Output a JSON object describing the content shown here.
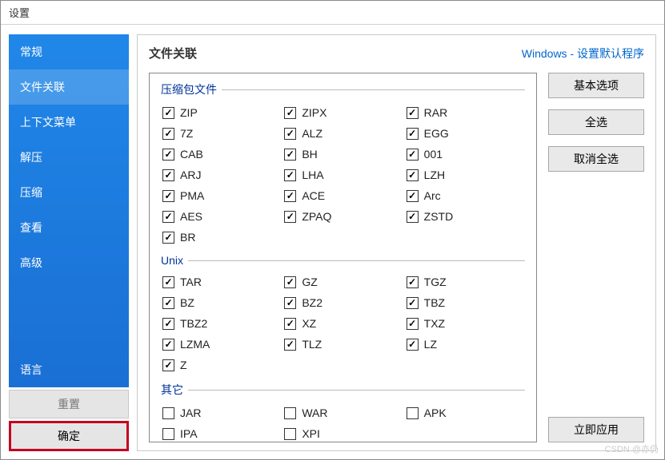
{
  "window": {
    "title": "设置"
  },
  "sidebar": {
    "items": [
      {
        "label": "常规"
      },
      {
        "label": "文件关联"
      },
      {
        "label": "上下文菜单"
      },
      {
        "label": "解压"
      },
      {
        "label": "压缩"
      },
      {
        "label": "查看"
      },
      {
        "label": "高级"
      }
    ],
    "bottom": [
      {
        "label": "语言"
      }
    ],
    "reset": "重置",
    "confirm": "确定"
  },
  "main": {
    "title": "文件关联",
    "link": "Windows - 设置默认程序",
    "groups": [
      {
        "legend": "压缩包文件",
        "items": [
          {
            "label": "ZIP",
            "checked": true
          },
          {
            "label": "ZIPX",
            "checked": true
          },
          {
            "label": "RAR",
            "checked": true
          },
          {
            "label": "7Z",
            "checked": true
          },
          {
            "label": "ALZ",
            "checked": true
          },
          {
            "label": "EGG",
            "checked": true
          },
          {
            "label": "CAB",
            "checked": true
          },
          {
            "label": "BH",
            "checked": true
          },
          {
            "label": "001",
            "checked": true
          },
          {
            "label": "ARJ",
            "checked": true
          },
          {
            "label": "LHA",
            "checked": true
          },
          {
            "label": "LZH",
            "checked": true
          },
          {
            "label": "PMA",
            "checked": true
          },
          {
            "label": "ACE",
            "checked": true
          },
          {
            "label": "Arc",
            "checked": true
          },
          {
            "label": "AES",
            "checked": true
          },
          {
            "label": "ZPAQ",
            "checked": true
          },
          {
            "label": "ZSTD",
            "checked": true
          },
          {
            "label": "BR",
            "checked": true
          }
        ]
      },
      {
        "legend": "Unix",
        "items": [
          {
            "label": "TAR",
            "checked": true
          },
          {
            "label": "GZ",
            "checked": true
          },
          {
            "label": "TGZ",
            "checked": true
          },
          {
            "label": "BZ",
            "checked": true
          },
          {
            "label": "BZ2",
            "checked": true
          },
          {
            "label": "TBZ",
            "checked": true
          },
          {
            "label": "TBZ2",
            "checked": true
          },
          {
            "label": "XZ",
            "checked": true
          },
          {
            "label": "TXZ",
            "checked": true
          },
          {
            "label": "LZMA",
            "checked": true
          },
          {
            "label": "TLZ",
            "checked": true
          },
          {
            "label": "LZ",
            "checked": true
          },
          {
            "label": "Z",
            "checked": true
          }
        ]
      },
      {
        "legend": "其它",
        "items": [
          {
            "label": "JAR",
            "checked": false
          },
          {
            "label": "WAR",
            "checked": false
          },
          {
            "label": "APK",
            "checked": false
          },
          {
            "label": "IPA",
            "checked": false
          },
          {
            "label": "XPI",
            "checked": false
          }
        ]
      }
    ],
    "buttons": {
      "basic": "基本选项",
      "select_all": "全选",
      "deselect_all": "取消全选",
      "apply": "立即应用"
    }
  },
  "watermark": "CSDN @亦仍"
}
